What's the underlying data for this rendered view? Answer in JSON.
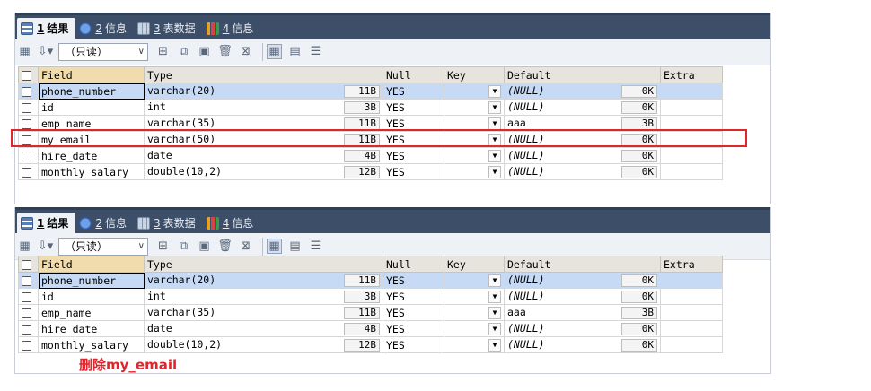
{
  "tabs": [
    {
      "num": "1",
      "label": "结果",
      "icon": "grid-icon"
    },
    {
      "num": "2",
      "label": "信息",
      "icon": "info-icon"
    },
    {
      "num": "3",
      "label": "表数据",
      "icon": "table-icon"
    },
    {
      "num": "4",
      "label": "信息",
      "icon": "chart-icon"
    }
  ],
  "toolbar": {
    "mode_select": "（只读）"
  },
  "columns": [
    "Field",
    "Type",
    "Null",
    "Key",
    "Default",
    "Extra"
  ],
  "table_before": [
    {
      "field": "phone_number",
      "type": "varchar(20)",
      "size": "11B",
      "null": "YES",
      "key": "",
      "default": "(NULL)",
      "dsize": "0K"
    },
    {
      "field": "id",
      "type": "int",
      "size": "3B",
      "null": "YES",
      "key": "",
      "default": "(NULL)",
      "dsize": "0K"
    },
    {
      "field": "emp_name",
      "type": "varchar(35)",
      "size": "11B",
      "null": "YES",
      "key": "",
      "default": "aaa",
      "dsize": "3B"
    },
    {
      "field": "my_email",
      "type": "varchar(50)",
      "size": "11B",
      "null": "YES",
      "key": "",
      "default": "(NULL)",
      "dsize": "0K"
    },
    {
      "field": "hire_date",
      "type": "date",
      "size": "4B",
      "null": "YES",
      "key": "",
      "default": "(NULL)",
      "dsize": "0K"
    },
    {
      "field": "monthly_salary",
      "type": "double(10,2)",
      "size": "12B",
      "null": "YES",
      "key": "",
      "default": "(NULL)",
      "dsize": "0K"
    }
  ],
  "table_after": [
    {
      "field": "phone_number",
      "type": "varchar(20)",
      "size": "11B",
      "null": "YES",
      "key": "",
      "default": "(NULL)",
      "dsize": "0K"
    },
    {
      "field": "id",
      "type": "int",
      "size": "3B",
      "null": "YES",
      "key": "",
      "default": "(NULL)",
      "dsize": "0K"
    },
    {
      "field": "emp_name",
      "type": "varchar(35)",
      "size": "11B",
      "null": "YES",
      "key": "",
      "default": "aaa",
      "dsize": "3B"
    },
    {
      "field": "hire_date",
      "type": "date",
      "size": "4B",
      "null": "YES",
      "key": "",
      "default": "(NULL)",
      "dsize": "0K"
    },
    {
      "field": "monthly_salary",
      "type": "double(10,2)",
      "size": "12B",
      "null": "YES",
      "key": "",
      "default": "(NULL)",
      "dsize": "0K"
    }
  ],
  "annotation": "删除my_email",
  "colors": {
    "highlight_box": "#e0262d",
    "selected_row": "#c6daf6",
    "tabbar": "#3c4e68"
  }
}
